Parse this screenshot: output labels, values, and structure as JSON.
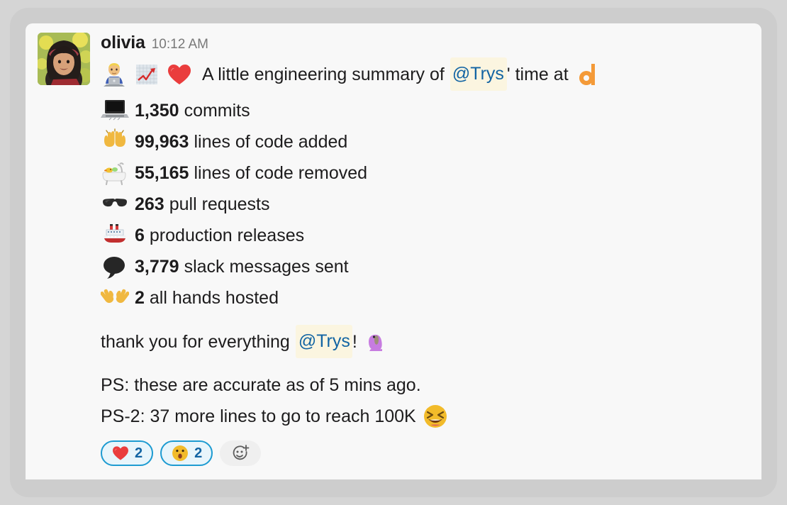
{
  "window": {
    "background_color": "#d5d5d5",
    "card_background_color": "#f8f8f8"
  },
  "message": {
    "username": "olivia",
    "timestamp": "10:12 AM",
    "avatar_name": "olivia-avatar-photo",
    "intro": {
      "emojis": [
        "man-technologist",
        "chart-increasing",
        "red-heart"
      ],
      "text_before": "A little engineering summary of",
      "mention": "@Trys",
      "text_after": "' time at",
      "trailing_emoji": "orange-d-logo"
    },
    "stats": [
      {
        "emoji": "laptop",
        "value": "1,350",
        "label": "commits"
      },
      {
        "emoji": "raising-hands",
        "value": "99,963",
        "label": "lines of code added"
      },
      {
        "emoji": "bathtub",
        "value": "55,165",
        "label": "lines of code removed"
      },
      {
        "emoji": "sunglasses",
        "value": "263",
        "label": "pull requests"
      },
      {
        "emoji": "ship",
        "value": "6",
        "label": "production releases"
      },
      {
        "emoji": "speech-balloon",
        "value": "3,779",
        "label": "slack messages sent"
      },
      {
        "emoji": "open-hands",
        "value": "2",
        "label": "all hands hosted"
      }
    ],
    "thanks": {
      "text_before": "thank you for everything",
      "mention": "@Trys",
      "text_after": "!",
      "trailing_emoji": "purple-parrot"
    },
    "postscripts": [
      {
        "text": "PS: these are accurate as of 5 mins ago.",
        "emoji": ""
      },
      {
        "text": "PS-2: 37 more lines to go to reach 100K",
        "emoji": "laughing-squinting-face"
      }
    ],
    "reactions": [
      {
        "emoji": "red-heart",
        "count": "2"
      },
      {
        "emoji": "face-with-open-mouth",
        "count": "2"
      }
    ],
    "add_reaction_label": "add-reaction"
  },
  "colors": {
    "mention_text": "#1264a3",
    "mention_background": "#fbf5e0",
    "reaction_border": "#1d9bd1",
    "reaction_fill": "#e8f5fb",
    "text": "#1d1c1d",
    "timestamp": "#797979",
    "logo_orange": "#f49a38"
  }
}
